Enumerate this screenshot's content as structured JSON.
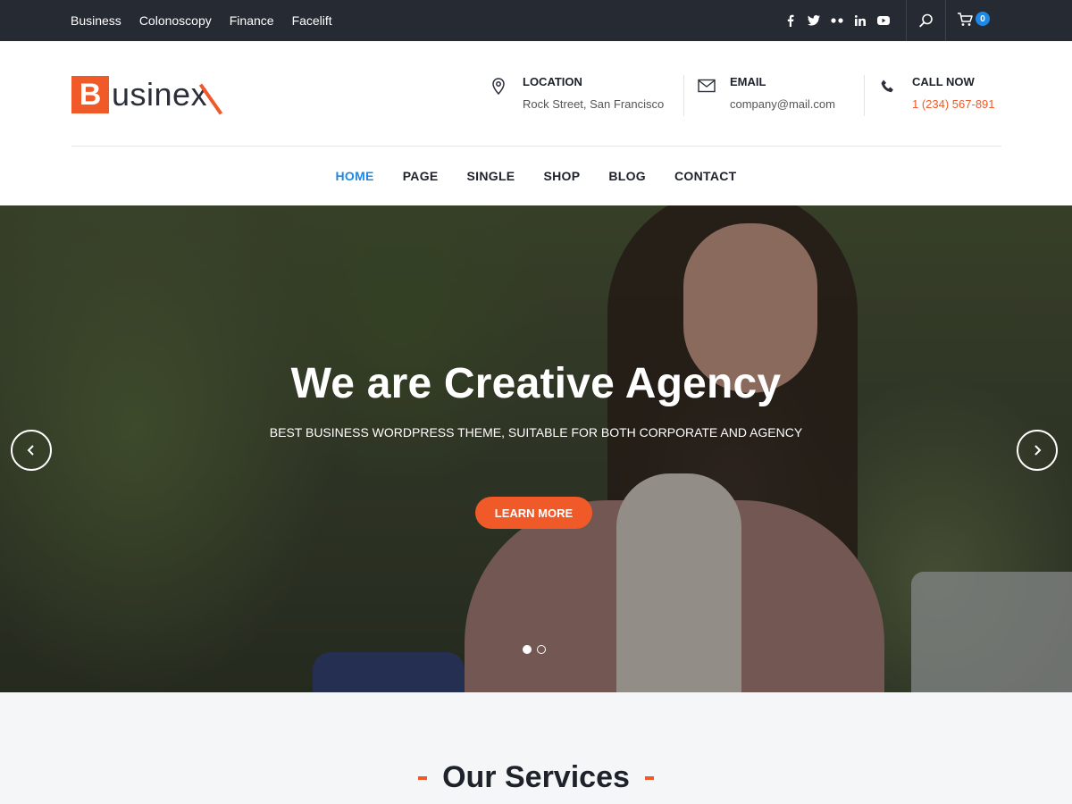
{
  "topbar": {
    "links": [
      "Business",
      "Colonoscopy",
      "Finance",
      "Facelift"
    ],
    "social_icons": [
      "facebook-icon",
      "twitter-icon",
      "flickr-icon",
      "linkedin-icon",
      "youtube-icon"
    ],
    "cart_count": "0"
  },
  "brand": {
    "logo_initial": "B",
    "logo_rest": "usine",
    "logo_last": "x"
  },
  "contact": {
    "location": {
      "title": "LOCATION",
      "value": "Rock Street, San Francisco"
    },
    "email": {
      "title": "EMAIL",
      "value": "company@mail.com"
    },
    "phone": {
      "title": "CALL NOW",
      "value": "1 (234) 567-891"
    }
  },
  "nav": [
    "HOME",
    "PAGE",
    "SINGLE",
    "SHOP",
    "BLOG",
    "CONTACT"
  ],
  "hero": {
    "title": "We are Creative Agency",
    "subtitle": "BEST BUSINESS WORDPRESS THEME, SUITABLE FOR BOTH CORPORATE AND AGENCY",
    "button": "LEARN MORE",
    "active_slide": 1,
    "slide_count": 2
  },
  "services": {
    "heading": "Our Services"
  },
  "colors": {
    "accent": "#f05a28",
    "link_active": "#1e88e5",
    "topbar_bg": "#262a33"
  }
}
